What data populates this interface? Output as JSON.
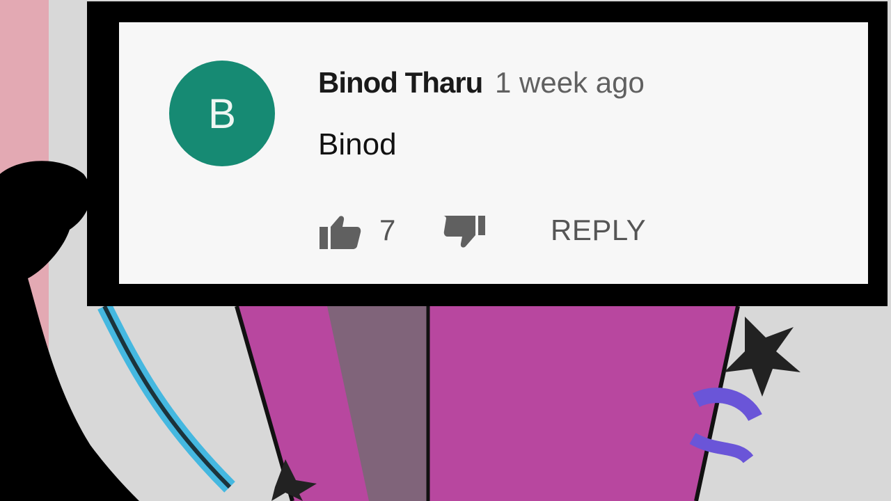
{
  "comment": {
    "avatar_letter": "B",
    "avatar_color": "#168a73",
    "author": "Binod Tharu",
    "timestamp": "1 week ago",
    "text": "Binod",
    "like_count": "7",
    "reply_label": "REPLY"
  },
  "icons": {
    "like": "thumbs-up-icon",
    "dislike": "thumbs-down-icon"
  },
  "colors": {
    "frame": "#000000",
    "card": "#f7f7f7",
    "drawing_magenta": "#b34aa3",
    "drawing_blue": "#45b8e0"
  }
}
